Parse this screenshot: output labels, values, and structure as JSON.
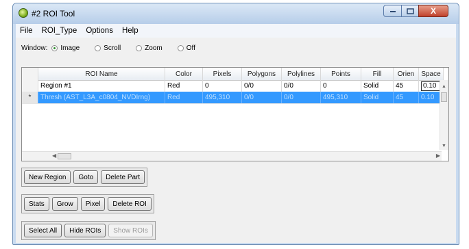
{
  "window": {
    "title": "#2 ROI Tool"
  },
  "titlebar_buttons": {
    "close_label": "X"
  },
  "menu": [
    "File",
    "ROI_Type",
    "Options",
    "Help"
  ],
  "window_select": {
    "label": "Window:",
    "options": [
      "Image",
      "Scroll",
      "Zoom",
      "Off"
    ],
    "selected": "Image"
  },
  "table": {
    "columns": [
      "ROI Name",
      "Color",
      "Pixels",
      "Polygons",
      "Polylines",
      "Points",
      "Fill",
      "Orien",
      "Space"
    ],
    "rows": [
      {
        "marker": "",
        "name": "Region #1",
        "color": "Red",
        "pixels": "0",
        "polygons": "0/0",
        "polylines": "0/0",
        "points": "0",
        "fill": "Solid",
        "orien": "45",
        "space": "0.10",
        "selected": false
      },
      {
        "marker": "*",
        "name": "Thresh (AST_L3A_c0804_NVDIrng)",
        "color": "Red",
        "pixels": "495,310",
        "polygons": "0/0",
        "polylines": "0/0",
        "points": "495,310",
        "fill": "Solid",
        "orien": "45",
        "space": "0.10",
        "selected": true
      }
    ]
  },
  "buttons": {
    "new_region": "New Region",
    "goto": "Goto",
    "delete_part": "Delete Part",
    "stats": "Stats",
    "grow": "Grow",
    "pixel": "Pixel",
    "delete_roi": "Delete ROI",
    "select_all": "Select All",
    "hide_rois": "Hide ROIs",
    "show_rois": "Show ROIs"
  }
}
